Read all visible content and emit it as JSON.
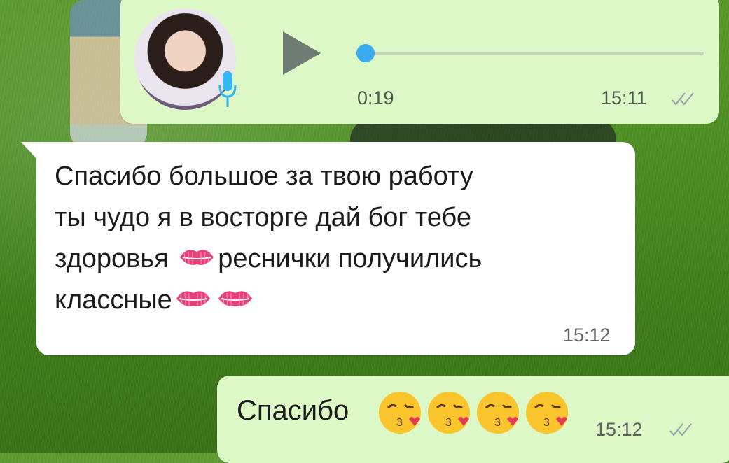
{
  "voice_message": {
    "avatar_alt": "",
    "duration": "0:19",
    "time": "15:11",
    "progress": 0.0,
    "read_receipt_icon": "double-check-icon",
    "colors": {
      "bubble": "#dcf8c6",
      "accent": "#34b7f1"
    }
  },
  "incoming_message": {
    "line1": "Спасибо большое за твою работу",
    "line2": "ты чудо я в восторге  дай бог тебе",
    "line3_a": "здоровья ",
    "line3_b": "реснички получились",
    "line4": "классные",
    "time": "15:12",
    "emoji_icons": [
      "kiss-mark-icon",
      "kiss-mark-icon",
      "kiss-mark-icon"
    ]
  },
  "outgoing_message": {
    "text": "Спасибо",
    "time": "15:12",
    "emoji_icons": [
      "face-blowing-kiss-icon",
      "face-blowing-kiss-icon",
      "face-blowing-kiss-icon",
      "face-blowing-kiss-icon"
    ],
    "read_receipt_icon": "double-check-icon"
  }
}
